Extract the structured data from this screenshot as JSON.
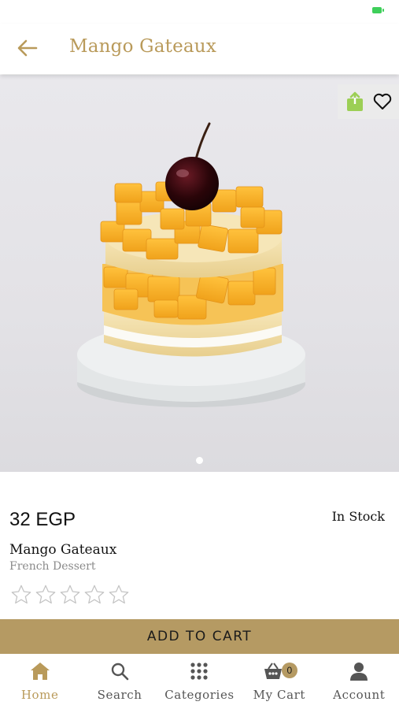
{
  "header": {
    "title": "Mango Gateaux"
  },
  "hero": {
    "image_alt": "Mango Gateaux",
    "slide_count": 1,
    "active_slide": 1
  },
  "product": {
    "price": "32 EGP",
    "stock_status": "In Stock",
    "name": "Mango Gateaux",
    "category": "French Dessert",
    "rating": 0,
    "rating_max": 5
  },
  "actions": {
    "add_to_cart": "ADD TO CART"
  },
  "tabbar": {
    "items": [
      {
        "label": "Home",
        "icon": "home-icon",
        "active": true
      },
      {
        "label": "Search",
        "icon": "search-icon",
        "active": false
      },
      {
        "label": "Categories",
        "icon": "grid-icon",
        "active": false
      },
      {
        "label": "My Cart",
        "icon": "cart-icon",
        "active": false,
        "badge": "0"
      },
      {
        "label": "Account",
        "icon": "user-icon",
        "active": false
      }
    ]
  },
  "colors": {
    "accent": "#b99a5a",
    "button": "#b59a63",
    "share": "#9ccf55"
  }
}
